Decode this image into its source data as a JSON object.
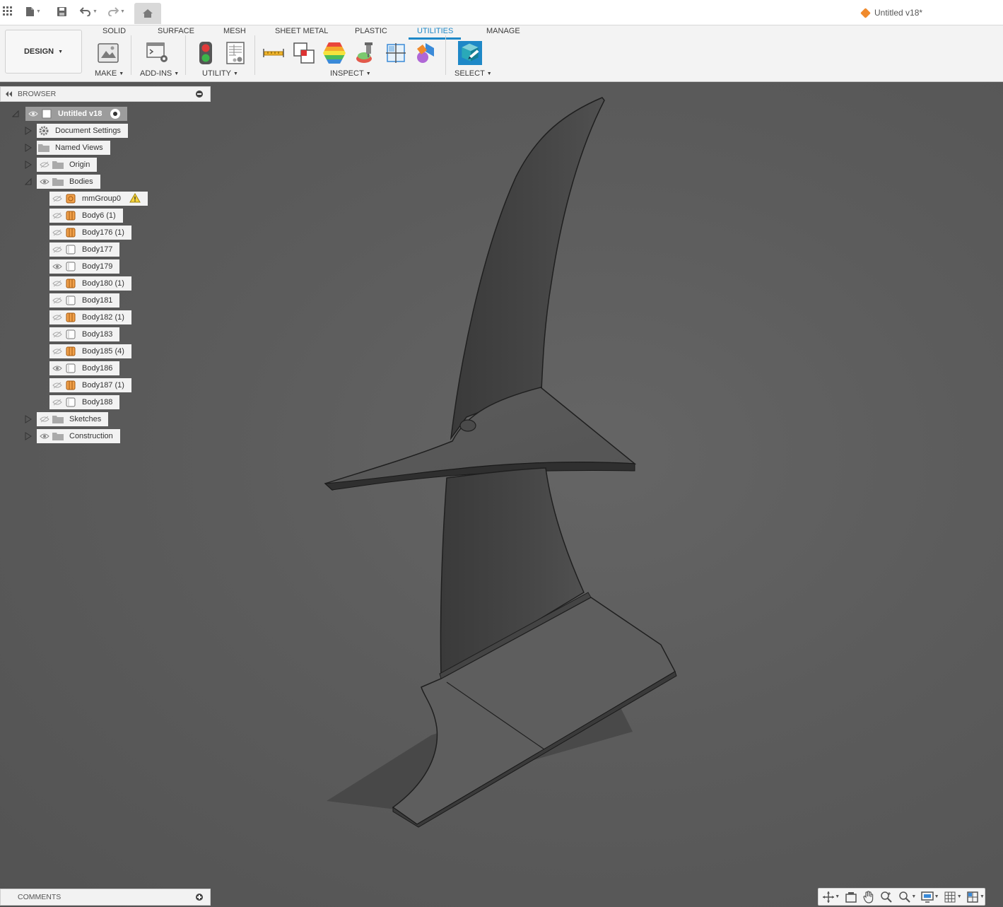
{
  "app": {
    "document_title": "Untitled v18*",
    "workspace": "DESIGN"
  },
  "ribbon": {
    "tabs": [
      {
        "label": "SOLID",
        "active": false
      },
      {
        "label": "SURFACE",
        "active": false
      },
      {
        "label": "MESH",
        "active": false
      },
      {
        "label": "SHEET METAL",
        "active": false
      },
      {
        "label": "PLASTIC",
        "active": false
      },
      {
        "label": "UTILITIES",
        "active": true
      },
      {
        "label": "MANAGE",
        "active": false
      }
    ],
    "groups": {
      "make": "MAKE",
      "addins": "ADD-INS",
      "utility": "UTILITY",
      "inspect": "INSPECT",
      "select": "SELECT"
    },
    "accent_color": "#1e88c7"
  },
  "browser": {
    "title": "BROWSER",
    "root": "Untitled v18",
    "folders": {
      "document_settings": "Document Settings",
      "named_views": "Named Views",
      "origin": "Origin",
      "bodies": "Bodies",
      "sketches": "Sketches",
      "construction": "Construction"
    },
    "bodies": [
      {
        "label": "mmGroup0",
        "icon": "group-icon",
        "visible": false,
        "warning": true
      },
      {
        "label": "Body6 (1)",
        "icon": "component-body-icon",
        "visible": false
      },
      {
        "label": "Body176 (1)",
        "icon": "component-body-icon",
        "visible": false
      },
      {
        "label": "Body177",
        "icon": "body-icon",
        "visible": false
      },
      {
        "label": "Body179",
        "icon": "body-icon",
        "visible": true
      },
      {
        "label": "Body180 (1)",
        "icon": "component-body-icon",
        "visible": false
      },
      {
        "label": "Body181",
        "icon": "body-icon",
        "visible": false
      },
      {
        "label": "Body182 (1)",
        "icon": "component-body-icon",
        "visible": false
      },
      {
        "label": "Body183",
        "icon": "body-icon",
        "visible": false
      },
      {
        "label": "Body185 (4)",
        "icon": "component-body-icon",
        "visible": false
      },
      {
        "label": "Body186",
        "icon": "body-icon",
        "visible": true
      },
      {
        "label": "Body187 (1)",
        "icon": "component-body-icon",
        "visible": false
      },
      {
        "label": "Body188",
        "icon": "body-icon",
        "visible": false
      }
    ]
  },
  "comments": {
    "title": "COMMENTS"
  }
}
